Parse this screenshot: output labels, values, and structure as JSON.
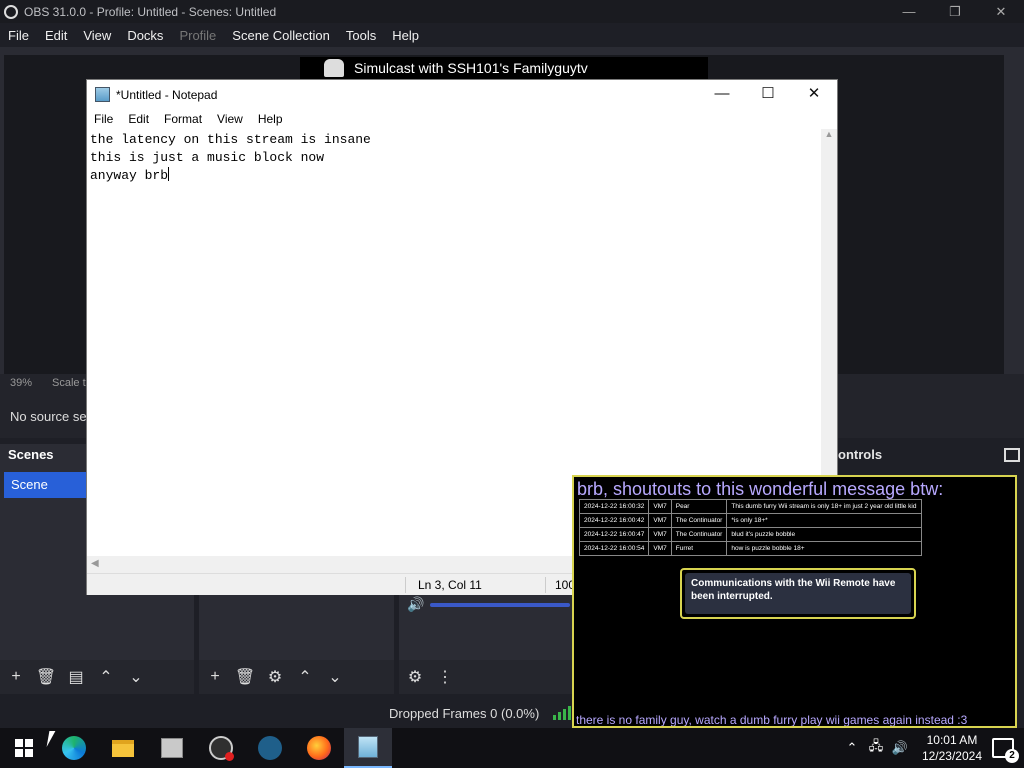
{
  "obs": {
    "title": "OBS 31.0.0 - Profile: Untitled - Scenes: Untitled",
    "window_controls": [
      "—",
      "❐",
      "✕"
    ],
    "menu": [
      "File",
      "Edit",
      "View",
      "Docks",
      "Profile",
      "Scene Collection",
      "Tools",
      "Help"
    ],
    "banner_text": "Simulcast with SSH101's Familyguytv",
    "zoom": "39%",
    "scale_label": "Scale to",
    "source_line": "No source se",
    "scenes_title": "Scenes",
    "scene_item": "Scene",
    "controls_title": "ontrols",
    "dropped_frames": "Dropped Frames 0 (0.0%)"
  },
  "notepad": {
    "title": "*Untitled - Notepad",
    "window_controls": [
      "—",
      "☐",
      "✕"
    ],
    "menu": [
      "File",
      "Edit",
      "Format",
      "View",
      "Help"
    ],
    "lines": [
      "the latency on this stream is insane",
      "this is just a music block now",
      "anyway brb"
    ],
    "status_position": "Ln 3, Col 11",
    "status_zoom": "100"
  },
  "overlay": {
    "heading": "brb, shoutouts to this wonderful message btw:",
    "messages": [
      {
        "time": "2024-12-22 16:00:32",
        "tag": "VM7",
        "user": "Pear",
        "text": "This dumb furry Wii stream is only 18+ im just 2 year old little kid"
      },
      {
        "time": "2024-12-22 16:00:42",
        "tag": "VM7",
        "user": "The Continuator",
        "text": "*is only 18+*"
      },
      {
        "time": "2024-12-22 16:00:47",
        "tag": "VM7",
        "user": "The Continuator",
        "text": "blud it's puzzle bobble"
      },
      {
        "time": "2024-12-22 16:00:54",
        "tag": "VM7",
        "user": "Furret",
        "text": "how is puzzle bobble 18+"
      }
    ],
    "wii_message": "Communications with the Wii Remote have been interrupted.",
    "footer": "there is no family guy, watch a dumb furry play wii games again instead :3"
  },
  "taskbar": {
    "apps": [
      "start-icon",
      "edge-icon",
      "file-explorer-icon",
      "app-icon",
      "obs-icon",
      "app-icon",
      "firefox-icon",
      "notepad-icon"
    ],
    "time": "10:01 AM",
    "date": "12/23/2024",
    "notification_count": "2"
  },
  "colors": {
    "obs_bg": "#1e1f26",
    "scene_selected": "#2860d8",
    "overlay_border": "#d8d450",
    "overlay_text": "#b8a9ff"
  }
}
